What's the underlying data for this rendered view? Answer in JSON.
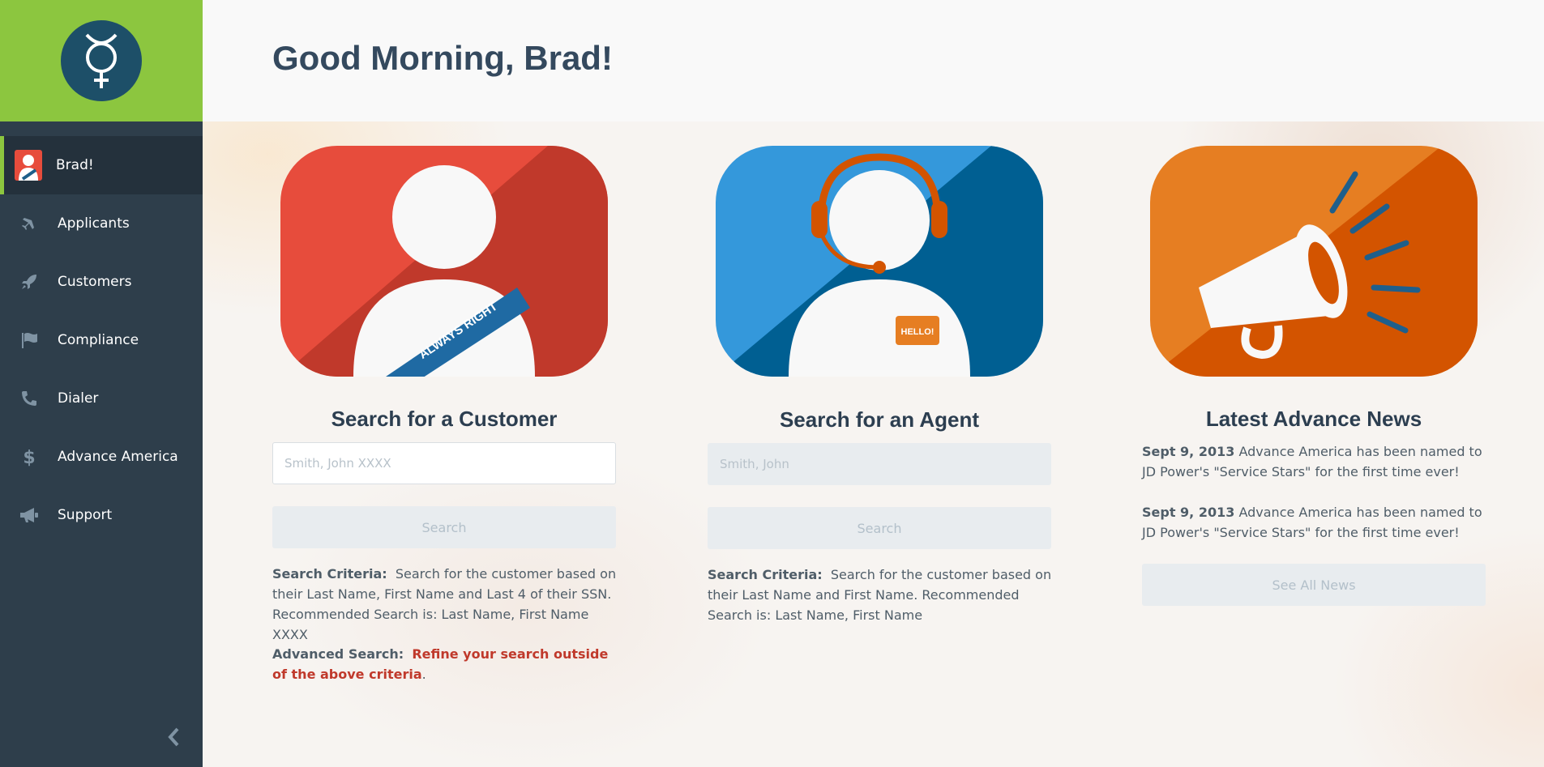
{
  "sidebar": {
    "logo_icon": "mercury-symbol-icon",
    "items": [
      {
        "label": "Brad!",
        "icon": "user-avatar"
      },
      {
        "label": "Applicants",
        "icon": "airplane-icon"
      },
      {
        "label": "Customers",
        "icon": "rocket-icon"
      },
      {
        "label": "Compliance",
        "icon": "flag-icon"
      },
      {
        "label": "Dialer",
        "icon": "phone-icon"
      },
      {
        "label": "Advance America",
        "icon": "dollar-icon"
      },
      {
        "label": "Support",
        "icon": "megaphone-icon"
      }
    ],
    "collapse_icon": "chevron-left-icon"
  },
  "header": {
    "greeting": "Good Morning, Brad!"
  },
  "customer": {
    "banner_text": "ALWAYS RIGHT",
    "title": "Search for a Customer",
    "placeholder": "Smith, John XXXX",
    "button": "Search",
    "criteria_label": "Search Criteria:",
    "criteria_text": "Search for the customer based on their Last Name, First Name and Last 4 of their SSN. Recommended Search is: Last Name, First Name XXXX",
    "advanced_label": "Advanced Search:",
    "advanced_link": "Refine your search outside of the above criteria",
    "advanced_end": "."
  },
  "agent": {
    "badge_text": "HELLO!",
    "title": "Search for an Agent",
    "placeholder": "Smith, John",
    "button": "Search",
    "criteria_label": "Search Criteria:",
    "criteria_text": "Search for the customer based on their Last Name and First Name. Recommended Search is: Last Name, First Name"
  },
  "news": {
    "title": "Latest Advance News",
    "items": [
      {
        "date": "Sept 9, 2013",
        "text": "Advance America has been named to JD Power's \"Service Stars\" for the first time ever!"
      },
      {
        "date": "Sept 9, 2013",
        "text": "Advance America has been named to JD Power's \"Service Stars\" for the first time ever!"
      }
    ],
    "button": "See All News"
  },
  "colors": {
    "sidebar_bg": "#2e3e4b",
    "logo_bg": "#8cc63f",
    "customer_red": "#e74c3c",
    "agent_blue": "#3498db",
    "news_orange": "#e67e22"
  }
}
